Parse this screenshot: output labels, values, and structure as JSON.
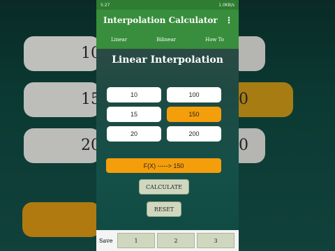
{
  "status": {
    "time": "5:27",
    "right": "1.0KB/s"
  },
  "app": {
    "title": "Interpolation Calculator",
    "menu_icon": "kebab-menu-icon"
  },
  "tabs": [
    {
      "label": "Linear"
    },
    {
      "label": "Bilinear"
    },
    {
      "label": "How To"
    }
  ],
  "section_title": "Linear Interpolation",
  "grid": {
    "r1": {
      "x": "10",
      "y": "100"
    },
    "r2": {
      "x": "15",
      "y": "150"
    },
    "r3": {
      "x": "20",
      "y": "200"
    }
  },
  "result": "F(X) -----> 150",
  "buttons": {
    "calculate": "CALCULATE",
    "reset": "RESET"
  },
  "bottom": {
    "save_label": "Save",
    "slots": [
      "1",
      "2",
      "3"
    ]
  },
  "ghost": {
    "a": "10",
    "b": "15",
    "c": "20",
    "d": "0",
    "e": "0"
  },
  "colors": {
    "appbar": "#388e3c",
    "highlight": "#f59e0b"
  }
}
